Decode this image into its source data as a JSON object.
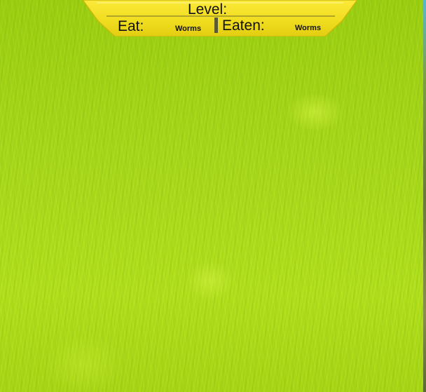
{
  "hud": {
    "level_label": "Level:",
    "eat_label": "Eat:",
    "eat_value": "Worms",
    "eaten_label": "Eaten:",
    "eaten_value": "Worms"
  },
  "colors": {
    "grass": "#a8d81a",
    "banner": "#f2e020",
    "banner_edge": "#c9b80a",
    "text": "#111111"
  }
}
